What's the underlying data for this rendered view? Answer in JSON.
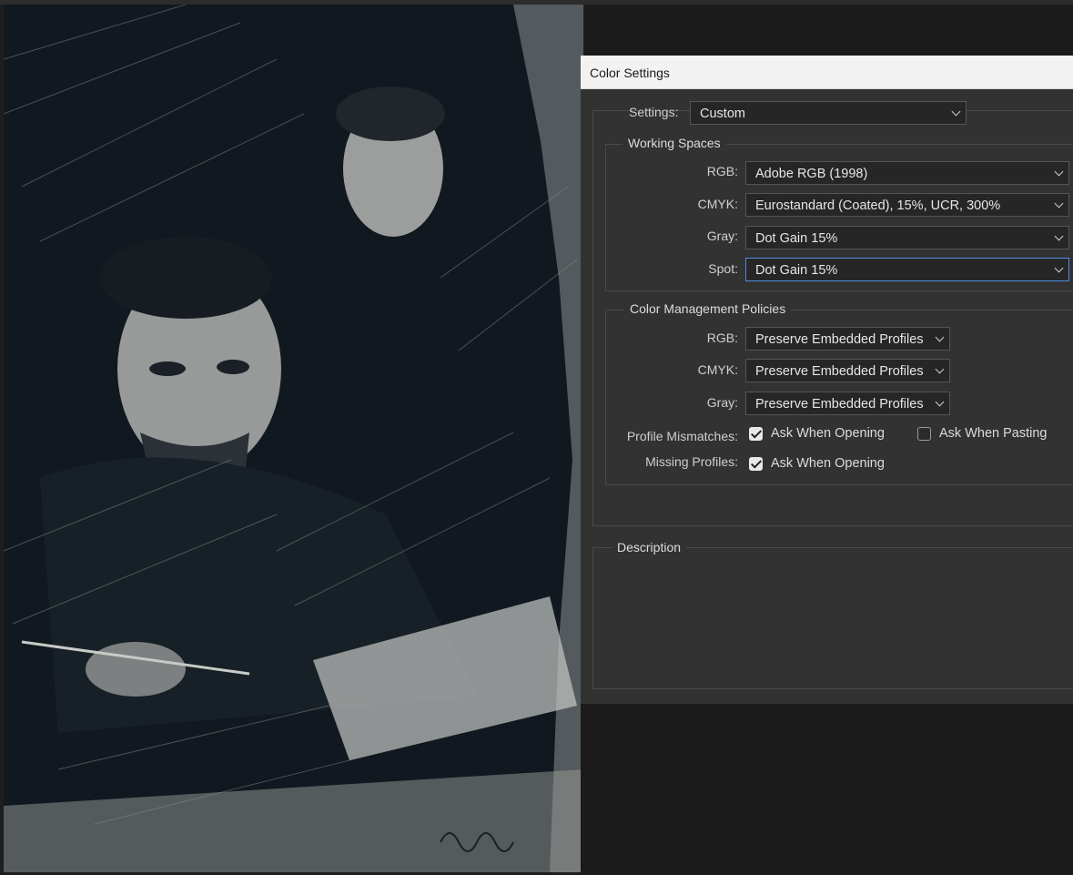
{
  "artwork": {
    "description_icon": "etching-portrait-image"
  },
  "dialog": {
    "title": "Color Settings",
    "settings": {
      "label": "Settings:",
      "value": "Custom"
    },
    "working_spaces": {
      "heading": "Working Spaces",
      "rgb": {
        "label": "RGB:",
        "value": "Adobe RGB (1998)"
      },
      "cmyk": {
        "label": "CMYK:",
        "value": "Eurostandard (Coated), 15%, UCR, 300%"
      },
      "gray": {
        "label": "Gray:",
        "value": "Dot Gain 15%"
      },
      "spot": {
        "label": "Spot:",
        "value": "Dot Gain 15%"
      }
    },
    "policies": {
      "heading": "Color Management Policies",
      "rgb": {
        "label": "RGB:",
        "value": "Preserve Embedded Profiles"
      },
      "cmyk": {
        "label": "CMYK:",
        "value": "Preserve Embedded Profiles"
      },
      "gray": {
        "label": "Gray:",
        "value": "Preserve Embedded Profiles"
      },
      "profile_mismatches": {
        "label": "Profile Mismatches:",
        "ask_opening": {
          "label": "Ask When Opening",
          "checked": true
        },
        "ask_pasting": {
          "label": "Ask When Pasting",
          "checked": false
        }
      },
      "missing_profiles": {
        "label": "Missing Profiles:",
        "ask_opening": {
          "label": "Ask When Opening",
          "checked": true
        }
      }
    },
    "description": {
      "heading": "Description"
    }
  },
  "colors": {
    "dialog_bg": "#323232",
    "field_bg": "#262626",
    "focus_border": "#4b8ee0",
    "titlebar_bg": "#f2f2f2"
  }
}
